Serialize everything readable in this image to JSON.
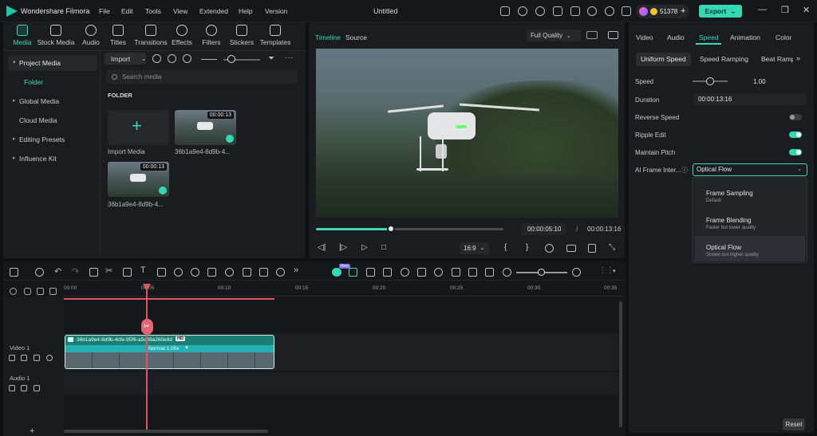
{
  "app": {
    "name": "Wondershare Filmora",
    "project_title": "Untitled"
  },
  "menu": [
    "File",
    "Edit",
    "Tools",
    "View",
    "Extended",
    "Help",
    "Version"
  ],
  "header": {
    "credits": "51378",
    "plus": "+",
    "export_label": "Export",
    "export_caret": "⌄"
  },
  "window_controls": {
    "min": "—",
    "max": "❐",
    "close": "✕"
  },
  "media_tabs": [
    "Media",
    "Stock Media",
    "Audio",
    "Titles",
    "Transitions",
    "Effects",
    "Filters",
    "Stickers",
    "Templates"
  ],
  "sidebar": [
    {
      "label": "Project Media",
      "caret": "▾"
    },
    {
      "label": "Folder",
      "caret": ""
    },
    {
      "label": "Global Media",
      "caret": "▸"
    },
    {
      "label": "Cloud Media",
      "caret": ""
    },
    {
      "label": "Editing Presets",
      "caret": "▸"
    },
    {
      "label": "Influence Kit",
      "caret": "▸"
    }
  ],
  "media_toolbar": {
    "import_label": "Import",
    "import_caret": "⌄",
    "search_placeholder": "Search media",
    "more": "···"
  },
  "media": {
    "folder_heading": "FOLDER",
    "import_card_label": "Import Media",
    "import_plus": "+",
    "clips": [
      {
        "name": "36b1a9e4-8d9b-4...",
        "duration": "00:00:13"
      },
      {
        "name": "36b1a9e4-8d9b-4...",
        "duration": "00:00:13"
      }
    ]
  },
  "preview": {
    "tabs": [
      "Timeline",
      "Source"
    ],
    "quality": "Full Quality",
    "quality_caret": "⌄",
    "current_time": "00:00:05:10",
    "separator": "/",
    "total_time": "00:00:13:16",
    "aspect_ratio": "16:9",
    "aspect_caret": "⌄",
    "progress": 0.4,
    "controls": {
      "prev": "◁|",
      "play_frame": "|▷",
      "play": "▷",
      "stop": "□",
      "mark_in": "{",
      "mark_out": "}"
    }
  },
  "properties": {
    "tabs": [
      "Video",
      "Audio",
      "Speed",
      "Animation",
      "Color"
    ],
    "active_tab": "Speed",
    "subtabs": [
      "Uniform Speed",
      "Speed Ramping",
      "Beat Ramp"
    ],
    "subtab_more": "»",
    "speed_label": "Speed",
    "speed_value": "1.00",
    "duration_label": "Duration",
    "duration_value": "00:00:13:16",
    "reverse_label": "Reverse Speed",
    "reverse_on": false,
    "ripple_label": "Ripple Edit",
    "ripple_on": true,
    "maintain_label": "Maintain Pitch",
    "maintain_on": true,
    "ai_label": "AI Frame Inter...",
    "ai_info": "ⓘ",
    "ai_value": "Optical Flow",
    "ai_caret": "⌄",
    "ai_options": [
      {
        "name": "Frame Sampling",
        "desc": "Default"
      },
      {
        "name": "Frame Blending",
        "desc": "Faster but lower quality"
      },
      {
        "name": "Optical Flow",
        "desc": "Slower but higher quality"
      }
    ],
    "reset_label": "Reset"
  },
  "timeline": {
    "ruler": [
      "00:00",
      "00:05",
      "00:10",
      "00:15",
      "00:20",
      "00:25",
      "00:30",
      "00:35"
    ],
    "tracks": [
      {
        "name": "Video 1"
      },
      {
        "name": "Audio 1"
      }
    ],
    "clip": {
      "name": "36b1a9e4-8d9b-4cfe-95f6-a5c88a260e9d",
      "badge": "HD",
      "speed_label": "Normal 1.00x",
      "speed_caret": "▼"
    },
    "add_track": "+",
    "ai_badge": "New"
  },
  "colors": {
    "accent": "#35d8b4",
    "playhead": "#e05565",
    "background": "#0f1012"
  }
}
